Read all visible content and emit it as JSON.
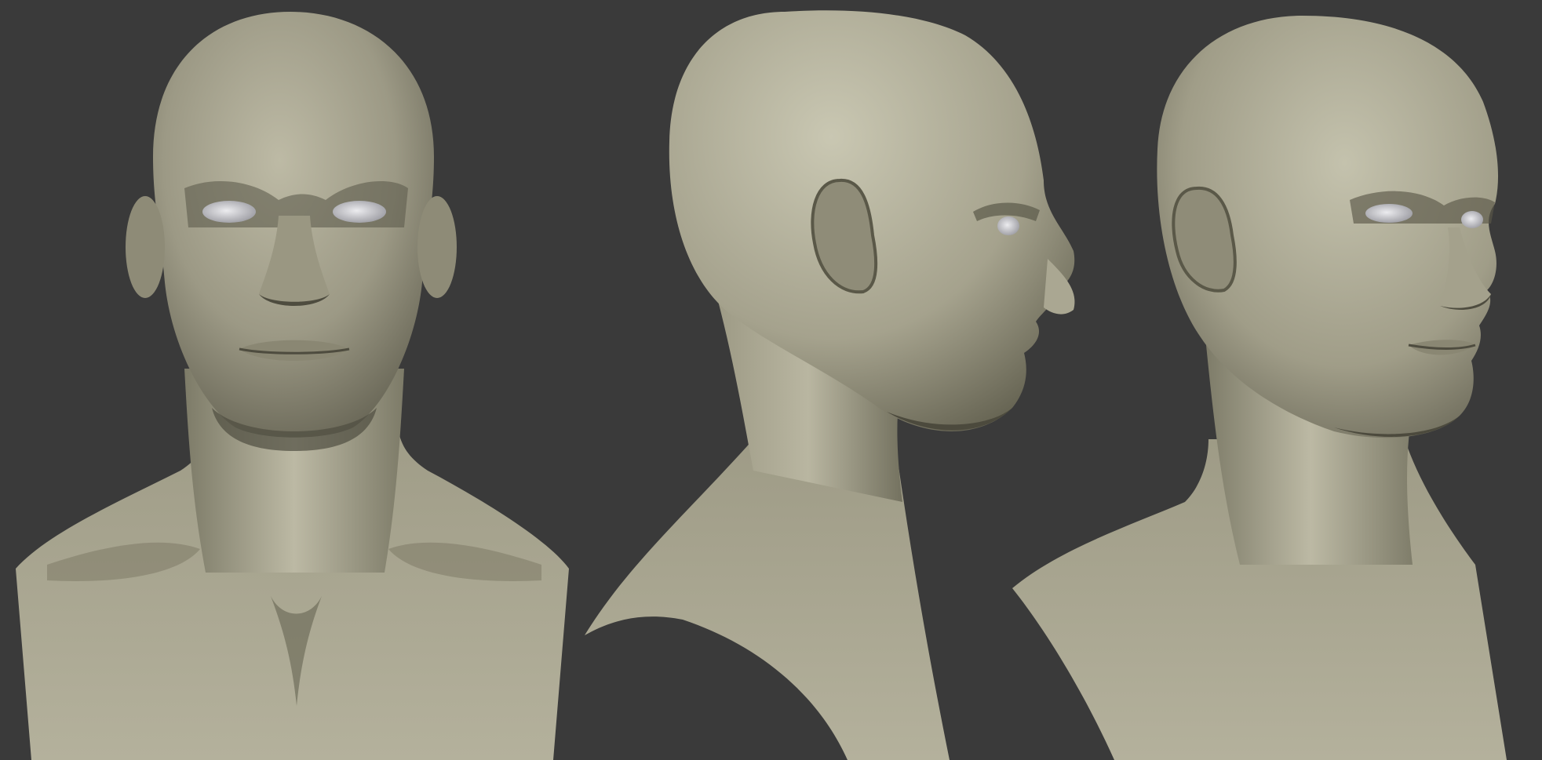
{
  "scene": {
    "background_color": "#3a3a3a",
    "clay_color": "#a8a590",
    "clay_highlight": "#cfcdb8",
    "clay_shadow": "#5a5848",
    "eye_color": "#d8d8dc",
    "views": [
      {
        "name": "front-view"
      },
      {
        "name": "side-view"
      },
      {
        "name": "three-quarter-view"
      }
    ]
  }
}
